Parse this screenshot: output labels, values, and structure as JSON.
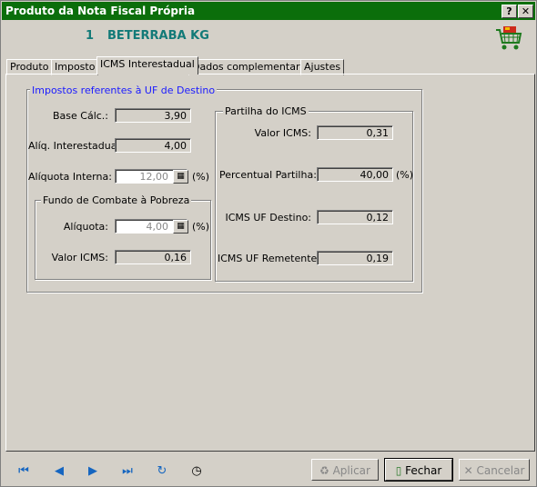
{
  "window": {
    "title": "Produto da Nota Fiscal Própria",
    "help_label": "?",
    "close_label": "✕"
  },
  "header": {
    "item_number": "1",
    "product_name": "BETERRABA KG",
    "cart_icon": "cart-icon"
  },
  "tabs": [
    {
      "label": "Produto"
    },
    {
      "label": "Imposto"
    },
    {
      "label": "ICMS Interestadual"
    },
    {
      "label": "Dados complementares"
    },
    {
      "label": "Ajustes"
    }
  ],
  "dest_group": {
    "title": "Impostos referentes à UF de Destino",
    "base_calc": {
      "label": "Base Cálc.:",
      "value": "3,90"
    },
    "aliq_interestadual": {
      "label": "Alíq. Interestadual:",
      "value": "4,00"
    },
    "aliq_interna": {
      "label": "Alíquota Interna:",
      "value": "12,00",
      "unit": "(%)"
    }
  },
  "fundo_group": {
    "title": "Fundo de Combate à Pobreza",
    "aliquota": {
      "label": "Alíquota:",
      "value": "4,00",
      "unit": "(%)"
    },
    "valor_icms": {
      "label": "Valor ICMS:",
      "value": "0,16"
    }
  },
  "partilha_group": {
    "title": "Partilha do ICMS",
    "valor_icms": {
      "label": "Valor ICMS:",
      "value": "0,31"
    },
    "percentual": {
      "label": "Percentual Partilha:",
      "value": "40,00",
      "unit": "(%)"
    },
    "icms_destino": {
      "label": "ICMS UF Destino:",
      "value": "0,12"
    },
    "icms_remetente": {
      "label": "ICMS UF Remetente:",
      "value": "0,19"
    }
  },
  "footer": {
    "aplicar_label": "Aplicar",
    "fechar_label": "Fechar",
    "cancelar_label": "Cancelar"
  },
  "colors": {
    "title_bar": "#0b6e0b",
    "header_text": "#127a78",
    "group_title": "#1a1aff",
    "nav_icons": "#1565c0"
  }
}
